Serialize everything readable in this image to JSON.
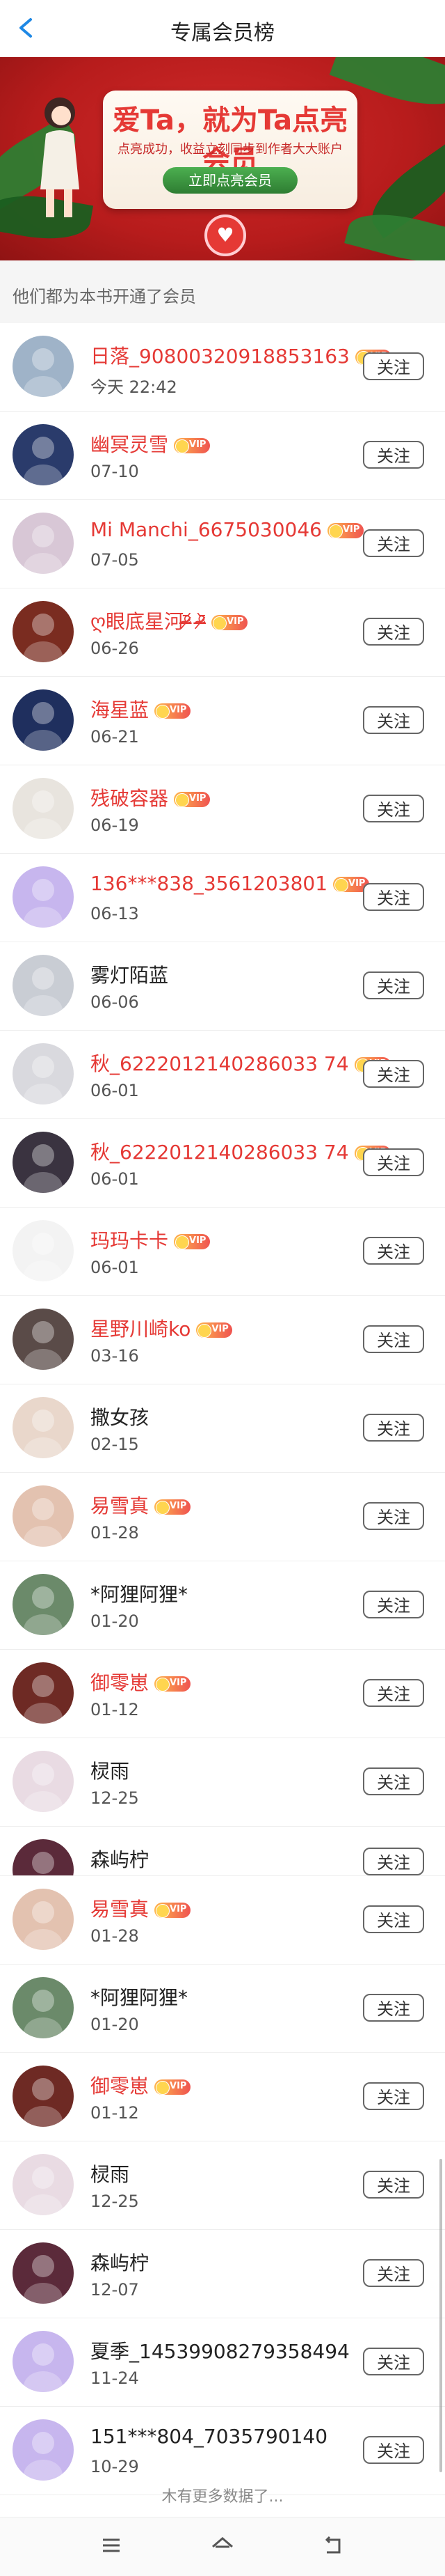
{
  "header": {
    "title": "专属会员榜"
  },
  "banner": {
    "headline": "爱Ta，就为Ta点亮会员",
    "subline": "点亮成功，收益立刻同步到作者大大账户",
    "button": "立即点亮会员"
  },
  "section": {
    "label": "他们都为本书开通了会员"
  },
  "vip_text": "VIP",
  "follow_label": "关注",
  "members": [
    {
      "name": "日落_90800320918853163",
      "date": "今天  22:42",
      "vip": true,
      "av": "#9fb3c8"
    },
    {
      "name": "幽冥灵雪",
      "date": "07-10",
      "vip": true,
      "av": "#2a3b6b"
    },
    {
      "name": "Mi  Manchi_6675030046",
      "date": "07-05",
      "vip": true,
      "av": "#d8c7d6"
    },
    {
      "name": "ღ眼底星河ᵒ̴̶̷᷄ ᵒ̴̶̷᷅",
      "date": "06-26",
      "vip": true,
      "av": "#7a2c20"
    },
    {
      "name": "海星蓝",
      "date": "06-21",
      "vip": true,
      "av": "#1f2f5e"
    },
    {
      "name": "残破容器",
      "date": "06-19",
      "vip": true,
      "av": "#e8e4de"
    },
    {
      "name": "136***838_3561203801",
      "date": "06-13",
      "vip": true,
      "av": "#c7b6ee"
    },
    {
      "name": "雾灯陌蓝",
      "date": "06-06",
      "vip": false,
      "av": "#c9cdd4"
    },
    {
      "name": "秋_6222012140286033 74",
      "date": "06-01",
      "vip": true,
      "av": "#d9d9de"
    },
    {
      "name": "秋_6222012140286033 74",
      "date": "06-01",
      "vip": true,
      "av": "#3a3340"
    },
    {
      "name": "玛玛卡卡",
      "date": "06-01",
      "vip": true,
      "av": "#f3f3f3"
    },
    {
      "name": "星野川崎ko",
      "date": "03-16",
      "vip": true,
      "av": "#5a4b48"
    },
    {
      "name": "撒女孩",
      "date": "02-15",
      "vip": false,
      "av": "#e9d7cb"
    },
    {
      "name": "易雪真",
      "date": "01-28",
      "vip": true,
      "av": "#e3c2b0"
    },
    {
      "name": "*阿狸阿狸*",
      "date": "01-20",
      "vip": false,
      "av": "#6b8a6a"
    },
    {
      "name": "御零崽",
      "date": "01-12",
      "vip": true,
      "av": "#6e2a24"
    },
    {
      "name": "棂雨",
      "date": "12-25",
      "vip": false,
      "av": "#e9dbe3"
    },
    {
      "name": "森屿柠",
      "date": "",
      "vip": false,
      "av": "#5b2a3a",
      "short": true
    },
    {
      "name": "易雪真",
      "date": "01-28",
      "vip": true,
      "av": "#e3c2b0"
    },
    {
      "name": "*阿狸阿狸*",
      "date": "01-20",
      "vip": false,
      "av": "#6b8a6a"
    },
    {
      "name": "御零崽",
      "date": "01-12",
      "vip": true,
      "av": "#6e2a24"
    },
    {
      "name": "棂雨",
      "date": "12-25",
      "vip": false,
      "av": "#e9dbe3"
    },
    {
      "name": "森屿柠",
      "date": "12-07",
      "vip": false,
      "av": "#5b2a3a"
    },
    {
      "name": "夏季_14539908279358494",
      "date": "11-24",
      "vip": false,
      "av": "#c7b6ee"
    },
    {
      "name": "151***804_7035790140",
      "date": "10-29",
      "vip": false,
      "av": "#c7b6ee"
    }
  ],
  "footer": {
    "text": "木有更多数据了..."
  },
  "colors": {
    "accent": "#e53935",
    "banner": "#b71c1c",
    "link": "#1e88e5"
  }
}
